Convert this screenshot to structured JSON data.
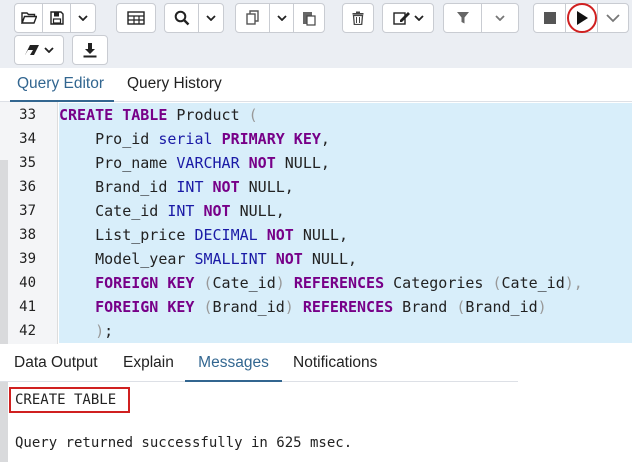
{
  "toolbar": {
    "buttons": [
      "open-file",
      "save",
      "save-dropdown",
      "table-view",
      "find",
      "find-dropdown",
      "copy",
      "copy-dropdown",
      "paste",
      "delete",
      "edit",
      "edit-dropdown",
      "filter",
      "filter-dropdown",
      "stop",
      "execute",
      "explain",
      "download"
    ]
  },
  "tabs": {
    "query_editor": "Query Editor",
    "query_history": "Query History"
  },
  "editor": {
    "line_numbers": [
      "33",
      "34",
      "35",
      "36",
      "37",
      "38",
      "39",
      "40",
      "41",
      "42"
    ],
    "lines": [
      [
        [
          "kw",
          "CREATE"
        ],
        [
          "pl",
          " "
        ],
        [
          "kw",
          "TABLE"
        ],
        [
          "pl",
          " Product "
        ],
        [
          "br",
          "("
        ]
      ],
      [
        [
          "pl",
          "    Pro_id "
        ],
        [
          "ty",
          "serial"
        ],
        [
          "pl",
          " "
        ],
        [
          "kw",
          "PRIMARY KEY"
        ],
        [
          "pl",
          ","
        ]
      ],
      [
        [
          "pl",
          "    Pro_name "
        ],
        [
          "ty",
          "VARCHAR"
        ],
        [
          "pl",
          " "
        ],
        [
          "kw",
          "NOT"
        ],
        [
          "pl",
          " NULL,"
        ]
      ],
      [
        [
          "pl",
          "    Brand_id "
        ],
        [
          "ty",
          "INT"
        ],
        [
          "pl",
          " "
        ],
        [
          "kw",
          "NOT"
        ],
        [
          "pl",
          " NULL,"
        ]
      ],
      [
        [
          "pl",
          "    Cate_id "
        ],
        [
          "ty",
          "INT"
        ],
        [
          "pl",
          " "
        ],
        [
          "kw",
          "NOT"
        ],
        [
          "pl",
          " NULL,"
        ]
      ],
      [
        [
          "pl",
          "    List_price "
        ],
        [
          "ty",
          "DECIMAL"
        ],
        [
          "pl",
          " "
        ],
        [
          "kw",
          "NOT"
        ],
        [
          "pl",
          " NULL,"
        ]
      ],
      [
        [
          "pl",
          "    Model_year "
        ],
        [
          "ty",
          "SMALLINT"
        ],
        [
          "pl",
          " "
        ],
        [
          "kw",
          "NOT"
        ],
        [
          "pl",
          " NULL,"
        ]
      ],
      [
        [
          "pl",
          "    "
        ],
        [
          "kw",
          "FOREIGN KEY"
        ],
        [
          "pl",
          " "
        ],
        [
          "br",
          "("
        ],
        [
          "pl",
          "Cate_id"
        ],
        [
          "br",
          ")"
        ],
        [
          "pl",
          " "
        ],
        [
          "kw",
          "REFERENCES"
        ],
        [
          "pl",
          " Categories "
        ],
        [
          "br",
          "("
        ],
        [
          "pl",
          "Cate_id"
        ],
        [
          "br",
          "),"
        ]
      ],
      [
        [
          "pl",
          "    "
        ],
        [
          "kw",
          "FOREIGN KEY"
        ],
        [
          "pl",
          " "
        ],
        [
          "br",
          "("
        ],
        [
          "pl",
          "Brand_id"
        ],
        [
          "br",
          ")"
        ],
        [
          "pl",
          " "
        ],
        [
          "kw",
          "REFERENCES"
        ],
        [
          "pl",
          " Brand "
        ],
        [
          "br",
          "("
        ],
        [
          "pl",
          "Brand_id"
        ],
        [
          "br",
          ")"
        ]
      ],
      [
        [
          "pl",
          "    "
        ],
        [
          "br",
          ")"
        ],
        [
          "pl",
          ";"
        ]
      ]
    ]
  },
  "output_tabs": {
    "data_output": "Data Output",
    "explain": "Explain",
    "messages": "Messages",
    "notifications": "Notifications"
  },
  "messages": {
    "status": "CREATE TABLE",
    "result": "Query returned successfully in 625 msec."
  },
  "colors": {
    "accent": "#326690",
    "highlight": "#d8eefa",
    "keyword": "#770088",
    "type": "#1a1aa6",
    "annotation": "#d02020"
  }
}
